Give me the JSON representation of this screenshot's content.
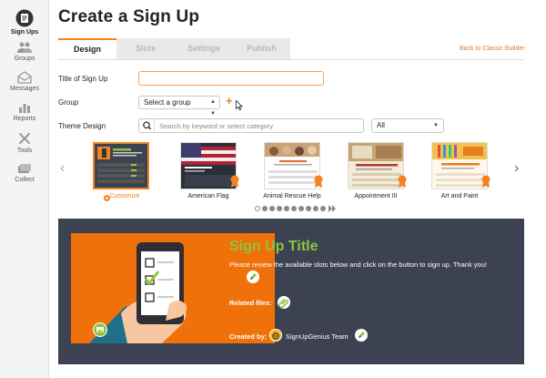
{
  "sidebar": {
    "items": [
      {
        "label": "Sign Ups",
        "icon": "signups-icon"
      },
      {
        "label": "Groups",
        "icon": "groups-icon"
      },
      {
        "label": "Messages",
        "icon": "messages-icon"
      },
      {
        "label": "Reports",
        "icon": "reports-icon"
      },
      {
        "label": "Tools",
        "icon": "tools-icon"
      },
      {
        "label": "Collect",
        "icon": "collect-icon"
      }
    ]
  },
  "header": {
    "title": "Create a Sign Up"
  },
  "tabs": [
    {
      "label": "Design",
      "active": true
    },
    {
      "label": "Slots",
      "active": false
    },
    {
      "label": "Settings",
      "active": false
    },
    {
      "label": "Publish",
      "active": false
    }
  ],
  "classic_link": "Back to Classic Builder",
  "form": {
    "title_label": "Title of Sign Up",
    "title_value": "",
    "group_label": "Group",
    "group_value": "Select a group",
    "theme_label": "Theme Design",
    "search_placeholder": "Search by keyword or select category",
    "category_value": "All"
  },
  "themes": [
    {
      "label": "Customize",
      "selected": true
    },
    {
      "label": "American Flag",
      "selected": false
    },
    {
      "label": "Animal Rescue Help",
      "selected": false
    },
    {
      "label": "Appointment III",
      "selected": false
    },
    {
      "label": "Art and Paint",
      "selected": false
    }
  ],
  "pager": {
    "count": 10,
    "current": 1
  },
  "preview": {
    "title": "Sign Up Title",
    "description": "Please review the available slots below and click on the button to sign up. Thank you!",
    "related_label": "Related files:",
    "created_label": "Created by:",
    "creator": "SignUpGenius Team"
  },
  "colors": {
    "accent": "#f58220",
    "preview_bg": "#3c4252",
    "title_green": "#8dc63f"
  }
}
